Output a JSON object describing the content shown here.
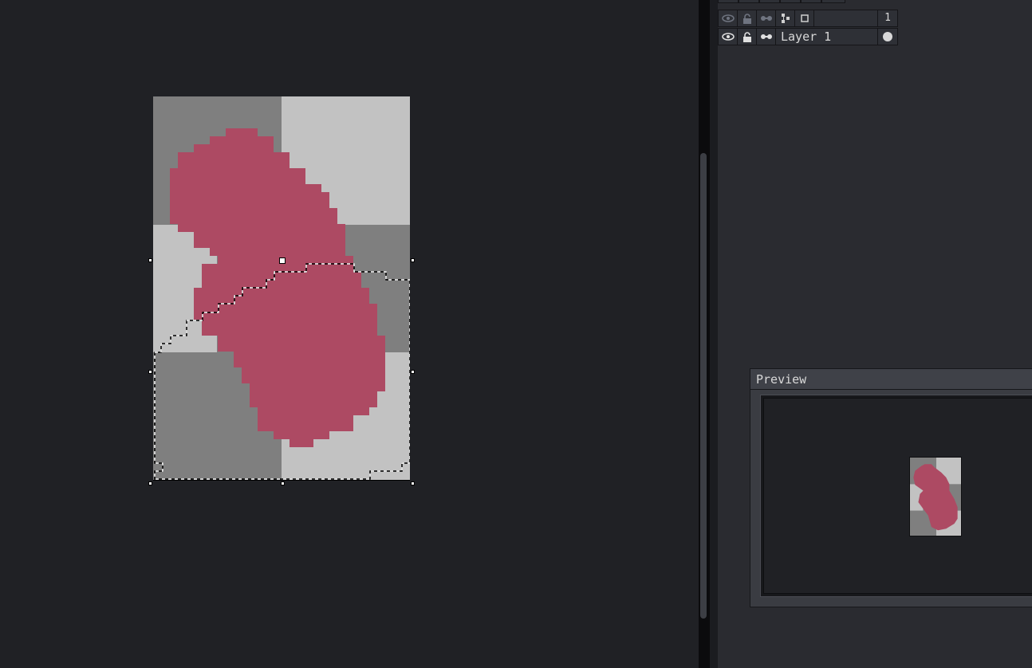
{
  "layers": {
    "header": {
      "frame_number": "1"
    },
    "items": [
      {
        "name": "Layer 1"
      }
    ]
  },
  "preview": {
    "title": "Preview"
  },
  "icons": {
    "visibility": "eye-icon",
    "lock": "padlock-icon",
    "continuous": "continuous-link-icon",
    "group": "layer-tree-icon",
    "new_layer": "square-icon",
    "cel": "filled-circle-icon"
  },
  "colors": {
    "canvas_bg": "#202125",
    "panel_bg": "#2a2b30",
    "sprite_pink": "#ad4a63",
    "sprite_dark_gray": "#7f7f7f",
    "sprite_light_gray": "#c2c2c2"
  }
}
